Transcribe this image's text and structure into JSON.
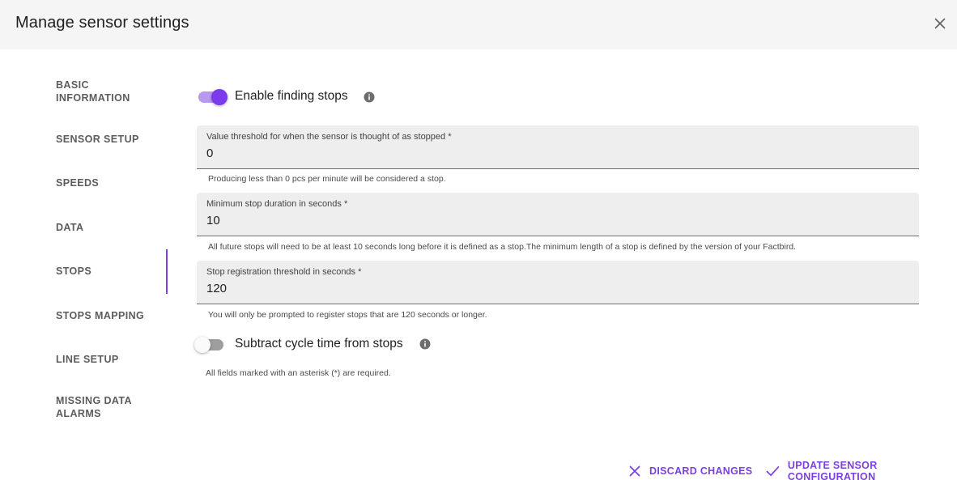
{
  "header": {
    "title": "Manage sensor settings"
  },
  "sidebar": {
    "items": [
      {
        "label": "BASIC INFORMATION"
      },
      {
        "label": "SENSOR SETUP"
      },
      {
        "label": "SPEEDS"
      },
      {
        "label": "DATA"
      },
      {
        "label": "STOPS"
      },
      {
        "label": "STOPS MAPPING"
      },
      {
        "label": "LINE SETUP"
      },
      {
        "label": "MISSING DATA ALARMS"
      }
    ],
    "active": "STOPS"
  },
  "main": {
    "enable_finding_stops": {
      "label": "Enable finding stops",
      "checked": true
    },
    "fields": [
      {
        "label": "Value threshold for when the sensor is thought of as stopped *",
        "value": "0",
        "helper": "Producing less than 0 pcs per minute will be considered a stop."
      },
      {
        "label": "Minimum stop duration in seconds *",
        "value": "10",
        "helper": "All future stops will need to be at least 10 seconds long before it is defined as a stop.The minimum length of a stop is defined by the version of your Factbird."
      },
      {
        "label": "Stop registration threshold in seconds *",
        "value": "120",
        "helper": "You will only be prompted to register stops that are 120 seconds or longer."
      }
    ],
    "subtract_cycle_time": {
      "label": "Subtract cycle time from stops",
      "checked": false
    },
    "required_note": "All fields marked with an asterisk (*) are required."
  },
  "actions": {
    "discard_label": "DISCARD CHANGES",
    "update_label": "UPDATE SENSOR CONFIGURATION"
  },
  "colors": {
    "accent": "#7b3fe4",
    "header_bg": "#f5f5f5",
    "field_bg": "#eeeeee"
  },
  "icons": [
    "close-icon",
    "info-icon",
    "x-icon",
    "check-icon"
  ]
}
